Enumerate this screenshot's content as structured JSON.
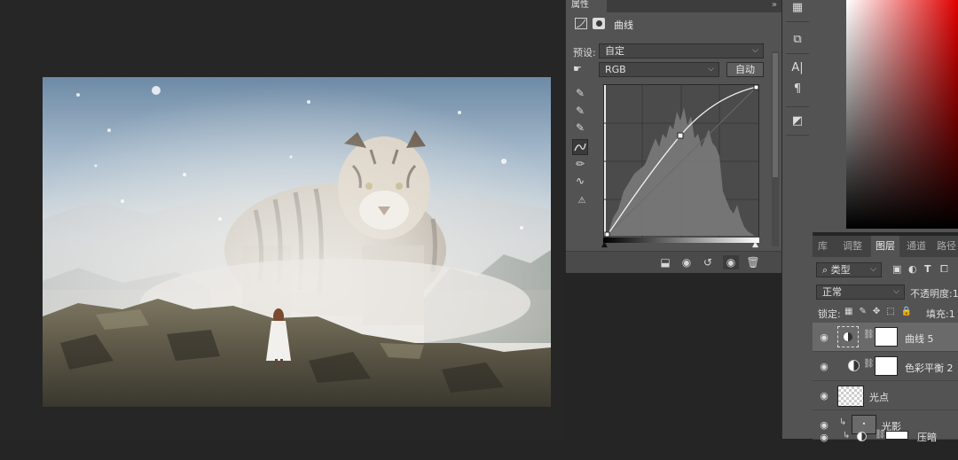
{
  "properties": {
    "tab_label": "属性",
    "menu_glyph": "»",
    "header_title": "曲线",
    "preset_label": "预设:",
    "preset_value": "自定",
    "channel_value": "RGB",
    "auto_button": "自动"
  },
  "layers_panel": {
    "tabs": [
      "库",
      "调整",
      "图层",
      "通道",
      "路径"
    ],
    "active_tab": "图层",
    "filter_kind": "类型",
    "blend_mode": "正常",
    "opacity_label": "不透明度:",
    "opacity_value": "1",
    "lock_label": "锁定:",
    "fill_label": "填充:",
    "fill_value": "1",
    "layers": [
      {
        "name": "曲线 5",
        "kind": "adjustment",
        "selected": true
      },
      {
        "name": "色彩平衡 2",
        "kind": "adjustment",
        "selected": false
      },
      {
        "name": "光点",
        "kind": "pixel",
        "selected": false
      },
      {
        "name": "光影",
        "kind": "pixel-clipped",
        "selected": false
      },
      {
        "name": "压暗",
        "kind": "adjustment-clipped",
        "selected": false
      }
    ]
  },
  "icons": {
    "eye": "eye-icon",
    "curve_tool": "curve-icon",
    "pencil_tool": "pencil-icon"
  },
  "colors": {
    "panel_bg": "#535353",
    "canvas_bg": "#262626",
    "color_field_red": "#cc0000"
  }
}
